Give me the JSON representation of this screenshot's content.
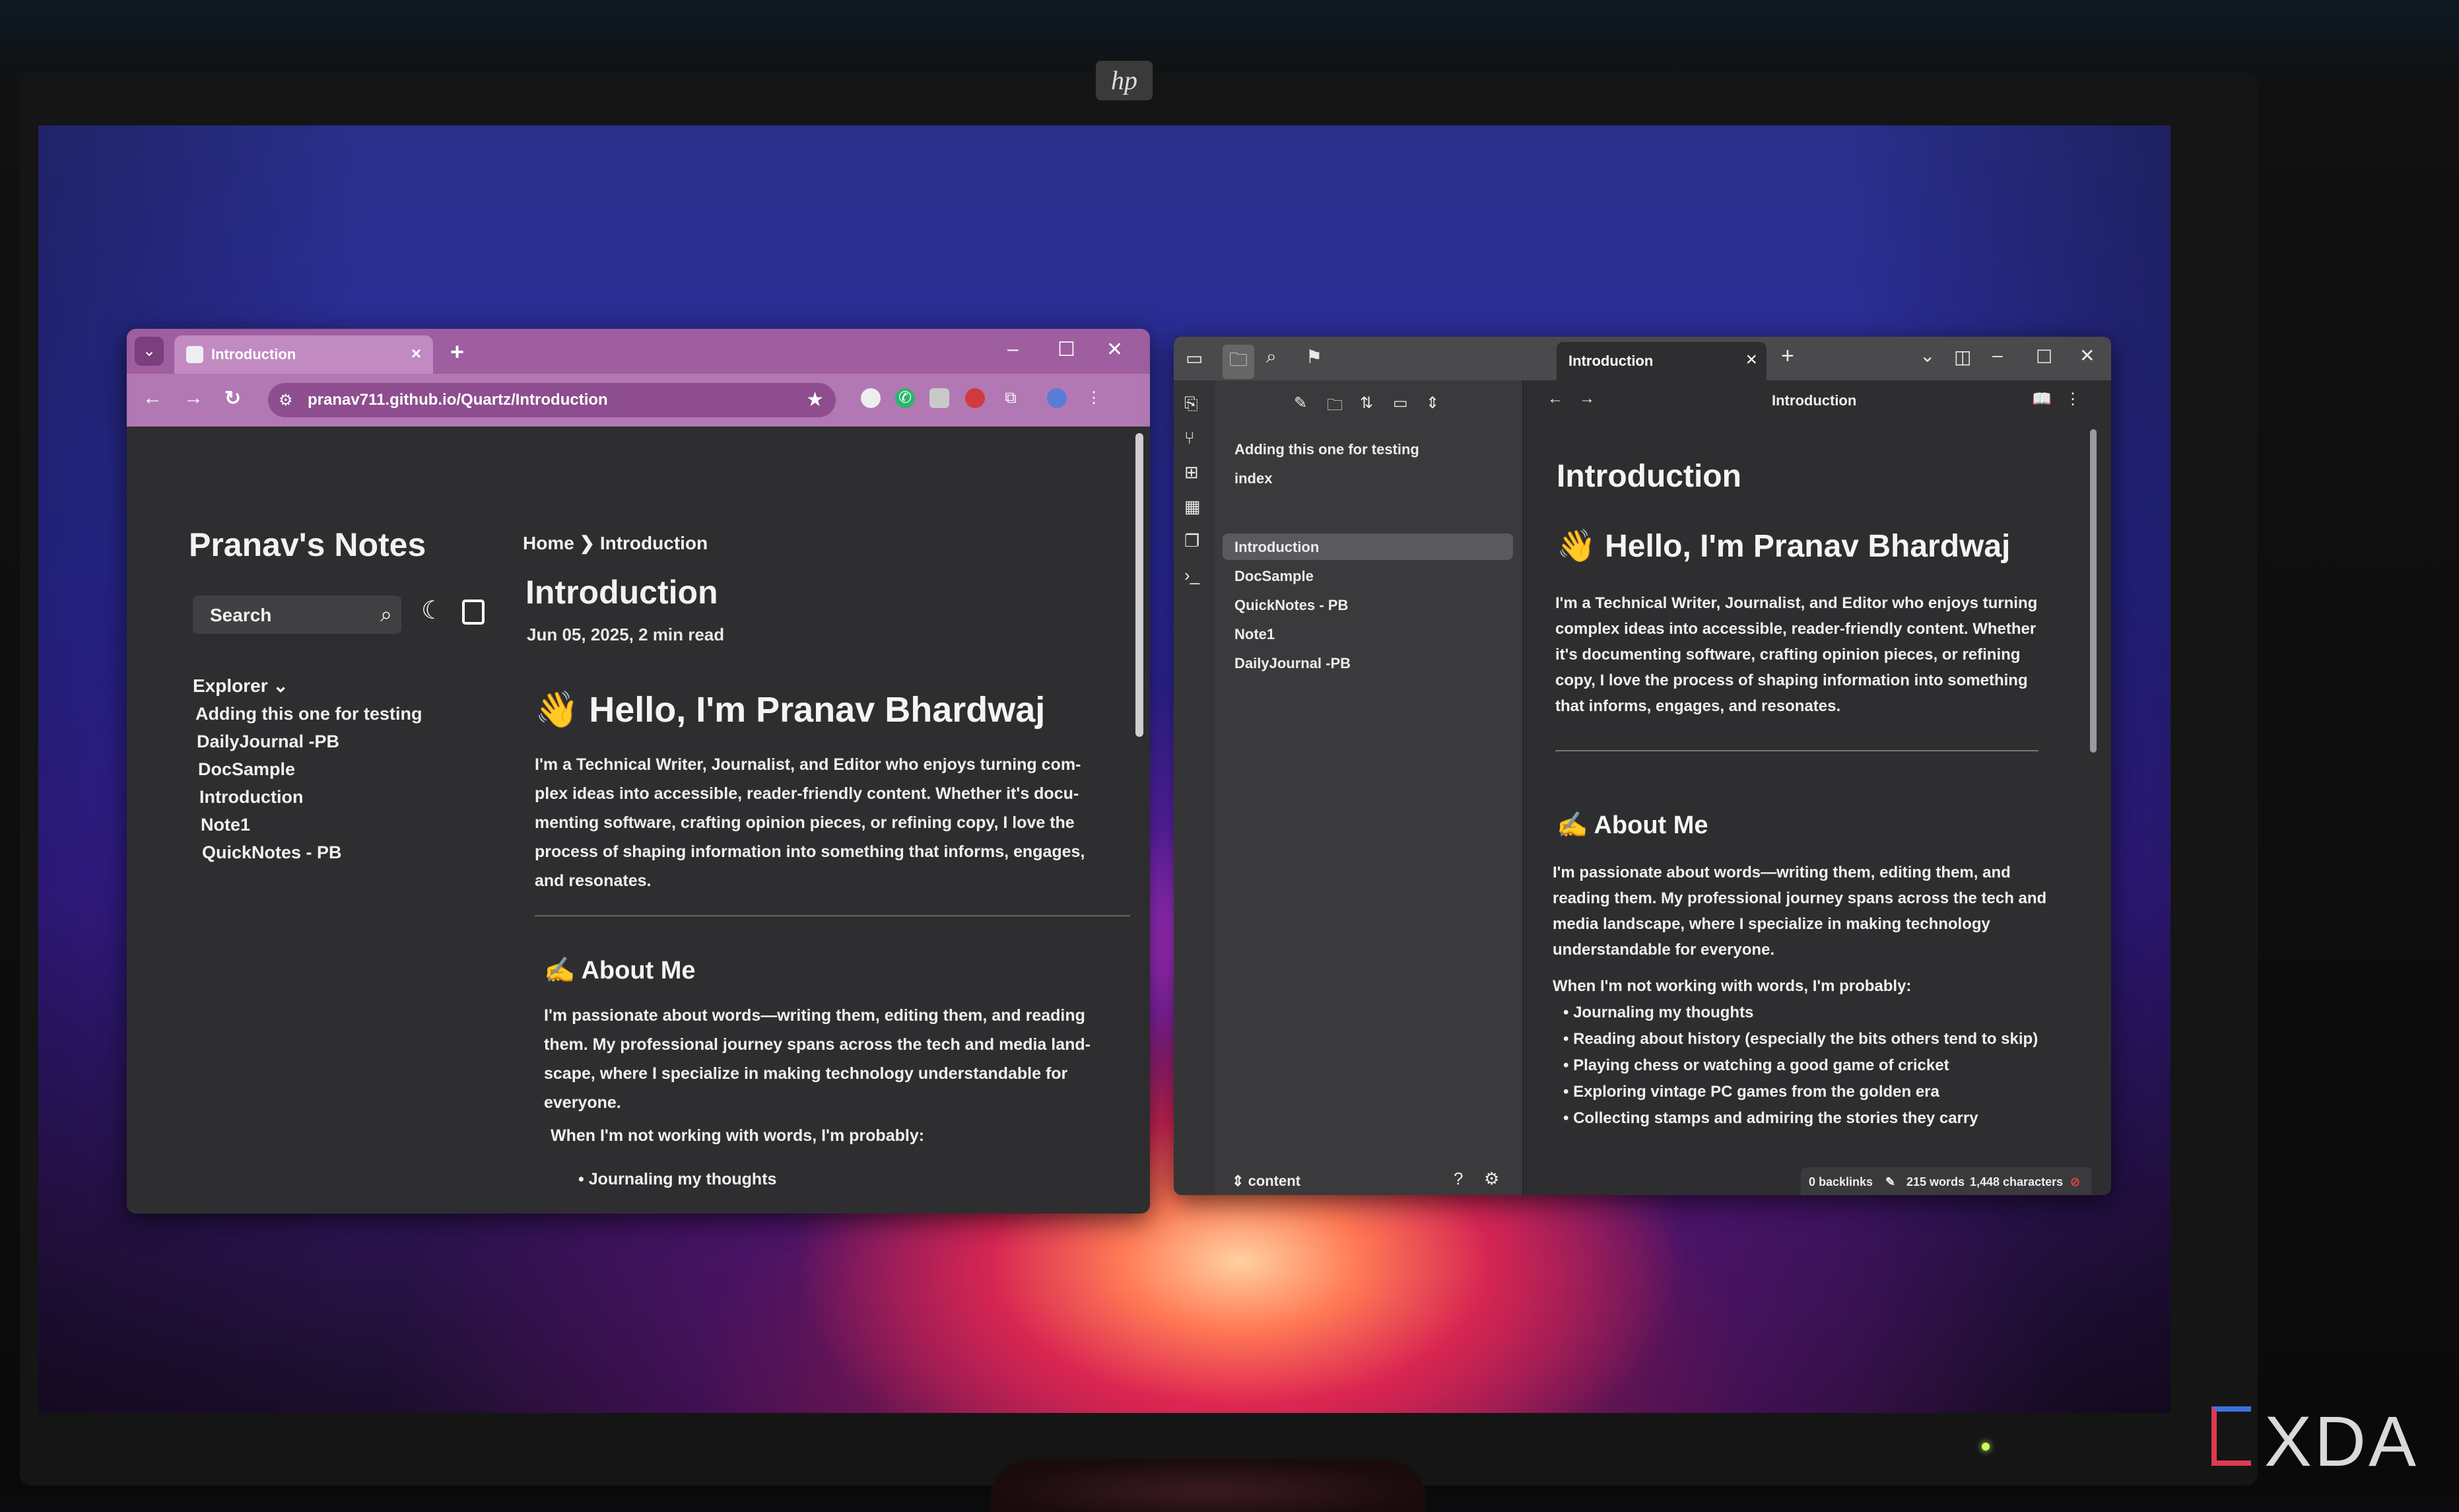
{
  "browser": {
    "tab_title": "Introduction",
    "url": "pranav711.github.io/Quartz/Introduction",
    "colors": {
      "accent": "#9e5ea0",
      "page_bg": "#2e2e30"
    }
  },
  "quartz": {
    "site_title": "Pranav's Notes",
    "search_placeholder": "Search",
    "explorer_label": "Explorer",
    "explorer_items": [
      "Adding this one for testing",
      "DailyJournal -PB",
      "DocSample",
      "Introduction",
      "Note1",
      "QuickNotes - PB"
    ],
    "breadcrumb_home": "Home",
    "breadcrumb_sep": "❯",
    "breadcrumb_current": "Introduction",
    "page_title": "Introduction",
    "meta": "Jun 05, 2025, 2 min read",
    "heading": "👋 Hello, I'm Pranav Bhardwaj",
    "intro_lines": [
      "I'm a Technical Writer, Journalist, and Editor who enjoys turning com-",
      "plex ideas into accessible, reader-friendly content. Whether it's docu-",
      "menting software, crafting opinion pieces, or refining copy, I love the",
      "process of shaping information into something that informs, engages,",
      "and resonates."
    ],
    "about_heading": "✍️ About Me",
    "about_lines": [
      "I'm passionate about words—writing them, editing them, and reading",
      "them. My professional journey spans across the tech and media land-",
      "scape, where I specialize in making technology understandable for",
      "everyone."
    ],
    "not_working": "When I'm not working with words, I'm probably:",
    "list_first": "Journaling my thoughts"
  },
  "obsidian": {
    "tab_title": "Introduction",
    "header_title": "Introduction",
    "files": [
      "Adding this one for testing",
      "index",
      "Introduction",
      "DocSample",
      "QuickNotes - PB",
      "Note1",
      "DailyJournal -PB"
    ],
    "vault_name": "content",
    "h1": "Introduction",
    "heading": "👋 Hello, I'm Pranav Bhardwaj",
    "intro_lines": [
      "I'm a Technical Writer, Journalist, and Editor who enjoys turning",
      "complex ideas into accessible, reader-friendly content. Whether",
      "it's documenting software, crafting opinion pieces, or refining",
      "copy, I love the process of shaping information into something",
      "that informs, engages, and resonates."
    ],
    "about_heading": "✍️ About Me",
    "about_lines": [
      "I'm passionate about words—writing them, editing them, and",
      "reading them. My professional journey spans across the tech and",
      "media landscape, where I specialize in making technology",
      "understandable for everyone."
    ],
    "not_working": "When I'm not working with words, I'm probably:",
    "list": [
      "Journaling my thoughts",
      "Reading about history (especially the bits others tend to skip)",
      "Playing chess or watching a good game of cricket",
      "Exploring vintage PC games from the golden era",
      "Collecting stamps and admiring the stories they carry"
    ],
    "status_backlinks": "0 backlinks",
    "status_words": "215 words",
    "status_chars": "1,448 characters"
  },
  "monitor": {
    "brand_logo": "hp"
  },
  "watermark": "XDA"
}
